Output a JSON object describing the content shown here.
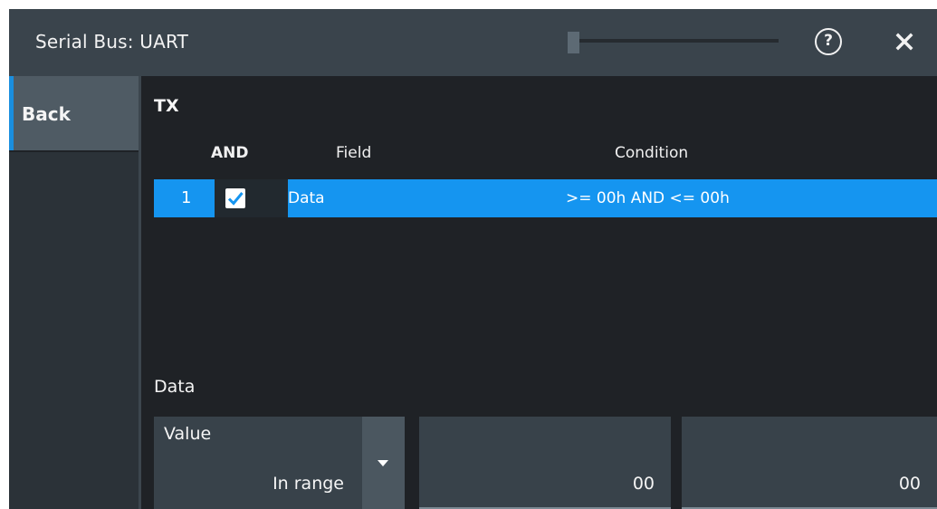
{
  "dialog": {
    "title": "Serial Bus: UART",
    "help_icon_text": "?",
    "help_icon": "help-circle-icon",
    "close_icon": "close-icon"
  },
  "sidebar": {
    "back_label": "Back"
  },
  "tx_section": {
    "title": "TX",
    "columns": {
      "and": "AND",
      "field": "Field",
      "condition": "Condition"
    },
    "rows": [
      {
        "index": "1",
        "and_checked": true,
        "field": "Data",
        "condition": ">= 00h AND <= 00h"
      }
    ]
  },
  "data_section": {
    "title": "Data",
    "value_label": "Value",
    "value_selected": "In range",
    "min_value": "00",
    "max_value": "00"
  },
  "colors": {
    "accent": "#1595f0",
    "titlebar": "#3a444c",
    "background": "#1f2226"
  }
}
